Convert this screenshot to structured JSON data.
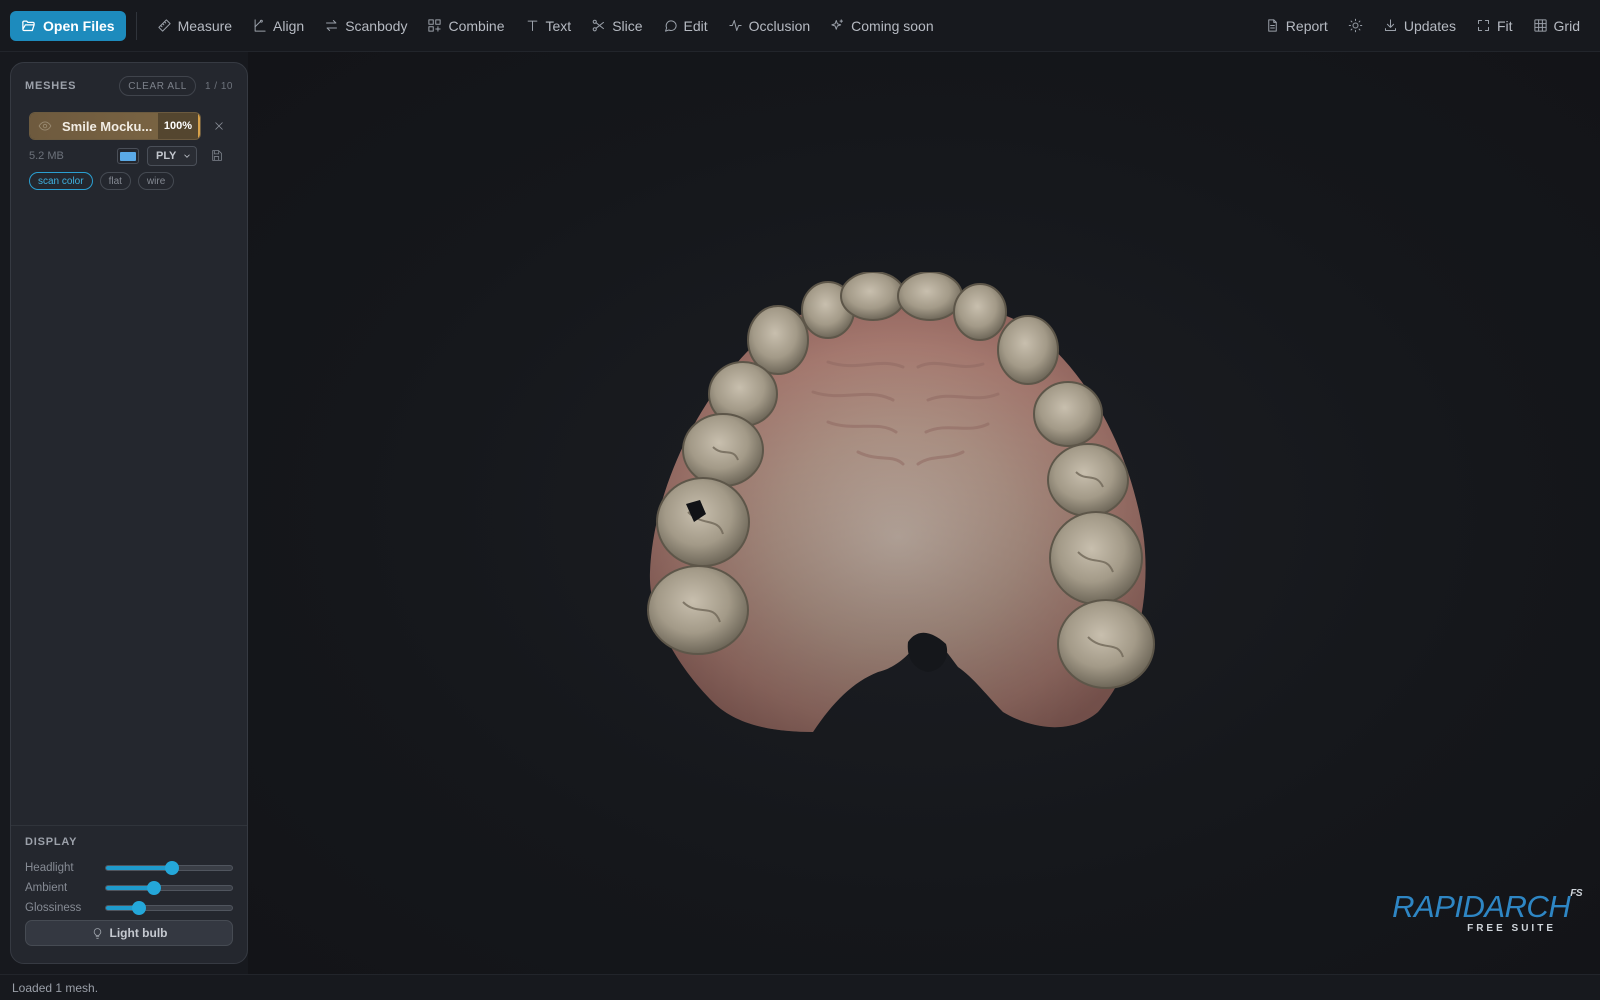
{
  "toolbar": {
    "open_files_label": "Open Files",
    "tools": [
      {
        "label": "Measure",
        "icon": "ruler-icon"
      },
      {
        "label": "Align",
        "icon": "align-icon"
      },
      {
        "label": "Scanbody",
        "icon": "swap-icon"
      },
      {
        "label": "Combine",
        "icon": "combine-icon"
      },
      {
        "label": "Text",
        "icon": "text-icon"
      },
      {
        "label": "Slice",
        "icon": "scissors-icon"
      },
      {
        "label": "Edit",
        "icon": "chat-icon"
      },
      {
        "label": "Occlusion",
        "icon": "activity-icon"
      },
      {
        "label": "Coming soon",
        "icon": "sparkles-icon"
      }
    ],
    "right_tools": [
      {
        "label": "Report",
        "icon": "document-icon"
      },
      {
        "label": "",
        "icon": "sun-icon"
      },
      {
        "label": "Updates",
        "icon": "download-icon"
      },
      {
        "label": "Fit",
        "icon": "fullscreen-icon"
      },
      {
        "label": "Grid",
        "icon": "grid-icon"
      }
    ]
  },
  "meshes_panel": {
    "title": "MESHES",
    "clear_all_label": "CLEAR ALL",
    "count": "1 / 10",
    "items": [
      {
        "name": "Smile Mocku...",
        "opacity": "100%",
        "opacity_fraction": 1.0,
        "size": "5.2 MB",
        "color": "#5aa9e6",
        "format": "PLY",
        "modes": [
          "scan color",
          "flat",
          "wire"
        ],
        "active_mode": "scan color"
      }
    ]
  },
  "display": {
    "title": "DISPLAY",
    "sliders": [
      {
        "label": "Headlight",
        "value": 0.52
      },
      {
        "label": "Ambient",
        "value": 0.38
      },
      {
        "label": "Glossiness",
        "value": 0.26
      }
    ],
    "light_bulb_label": "Light bulb"
  },
  "logo": {
    "name": "RAPIDARCH",
    "suffix": "FS",
    "tagline": "FREE SUITE"
  },
  "status": {
    "message": "Loaded 1 mesh."
  },
  "colors": {
    "accent": "#1d8bbd",
    "background": "#17191e",
    "panel": "#24272e",
    "logo": "#2e86c4"
  }
}
